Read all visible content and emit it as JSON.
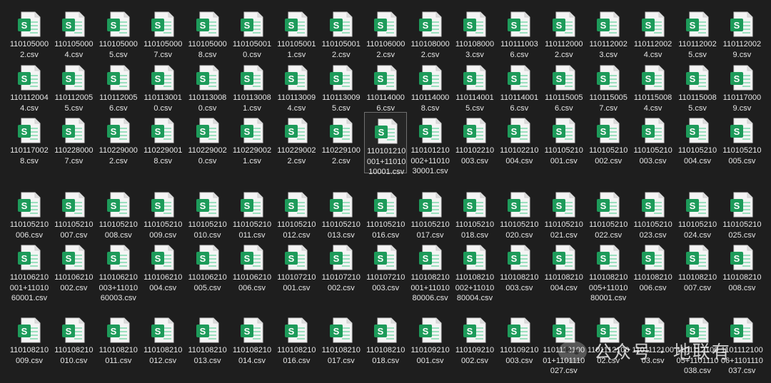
{
  "icon_name": "csv-spreadsheet-file-icon",
  "icon_letter": "S",
  "colors": {
    "background": "#1e1e1e",
    "icon_green": "#1d9b5a",
    "icon_green_light": "#5ed39a",
    "text": "#e6e6e6",
    "selection_border": "#6f6f6f"
  },
  "selected_file": "110101210001+1101010001.csv",
  "files": [
    [
      "1101050002.csv",
      "1101050004.csv",
      "1101050005.csv",
      "1101050007.csv",
      "1101050008.csv",
      "1101050010.csv",
      "1101050011.csv",
      "1101050012.csv",
      "1101060002.csv",
      "1101080002.csv",
      "1101080003.csv",
      "1101110036.csv",
      "1101120002.csv",
      "1101120023.csv",
      "1101120024.csv",
      "1101120025.csv",
      "1101120029.csv"
    ],
    [
      "1101120044.csv",
      "1101120055.csv",
      "1101120056.csv",
      "1101130010.csv",
      "1101130080.csv",
      "1101130081.csv",
      "1101130094.csv",
      "1101130095.csv",
      "1101140006.csv",
      "1101140008.csv",
      "1101140015.csv",
      "1101140016.csv",
      "1101150056.csv",
      "1101150057.csv",
      "1101150084.csv",
      "1101150085.csv",
      "1101170009.csv"
    ],
    [
      "1101170028.csv",
      "1102280007.csv",
      "1102290002.csv",
      "1102290018.csv",
      "1102290020.csv",
      "1102290021.csv",
      "1102290022.csv",
      "1102291002.csv",
      "110101210001+1101010001.csv",
      "110101210002+1101030001.csv",
      "110102210003.csv",
      "110102210004.csv",
      "110105210001.csv",
      "110105210002.csv",
      "110105210003.csv",
      "110105210004.csv",
      "110105210005.csv"
    ],
    [
      "110105210006.csv",
      "110105210007.csv",
      "110105210008.csv",
      "110105210009.csv",
      "110105210010.csv",
      "110105210011.csv",
      "110105210012.csv",
      "110105210013.csv",
      "110105210016.csv",
      "110105210017.csv",
      "110105210018.csv",
      "110105210020.csv",
      "110105210021.csv",
      "110105210022.csv",
      "110105210023.csv",
      "110105210024.csv",
      "110105210025.csv"
    ],
    [
      "110106210001+1101060001.csv",
      "110106210002.csv",
      "110106210003+1101060003.csv",
      "110106210004.csv",
      "110106210005.csv",
      "110106210006.csv",
      "110107210001.csv",
      "110107210002.csv",
      "110107210003.csv",
      "110108210001+1101080006.csv",
      "110108210002+1101080004.csv",
      "110108210003.csv",
      "110108210004.csv",
      "110108210005+1101080001.csv",
      "110108210006.csv",
      "110108210007.csv",
      "110108210008.csv"
    ],
    [
      "110108210009.csv",
      "110108210010.csv",
      "110108210011.csv",
      "110108210012.csv",
      "110108210013.csv",
      "110108210014.csv",
      "110108210016.csv",
      "110108210017.csv",
      "110108210018.csv",
      "110109210001.csv",
      "110109210002.csv",
      "110109210003.csv",
      "110111210001+1101110027.csv",
      "110111210002.csv",
      "110111210003.csv",
      "110111210005+1101110038.csv",
      "110111210006+1101110037.csv"
    ]
  ],
  "watermark": {
    "text": "公众号 · 地联有",
    "logo_icon": "wechat-logo-icon"
  }
}
